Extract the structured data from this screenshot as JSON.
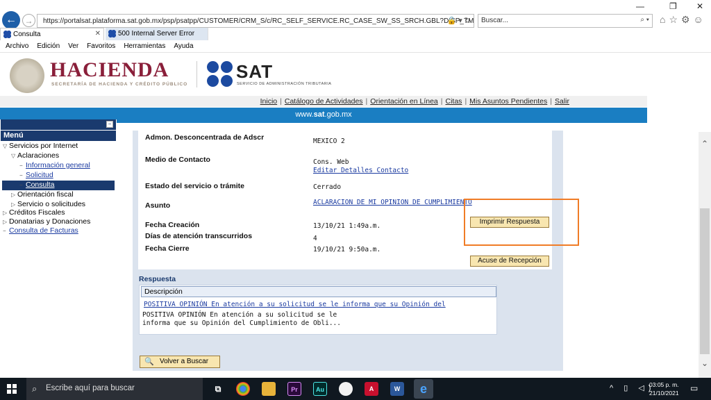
{
  "browser": {
    "url": "https://portalsat.plataforma.sat.gob.mx/psp/psatpp/CUSTOMER/CRM_S/c/RC_SELF_SERVICE.RC_CASE_SW_SS_SRCH.GBL?DISP_TMPL_ID=RC_SU",
    "search_placeholder": "Buscar...",
    "tabs": [
      {
        "label": "Consulta"
      },
      {
        "label": "500 Internal Server Error"
      }
    ],
    "menu": [
      "Archivo",
      "Edición",
      "Ver",
      "Favoritos",
      "Herramientas",
      "Ayuda"
    ]
  },
  "header": {
    "hacienda": "HACIENDA",
    "hacienda_sub": "SECRETARÍA DE HACIENDA Y CRÉDITO PÚBLICO",
    "sat": "SAT",
    "sat_sub": "SERVICIO DE ADMINISTRACIÓN TRIBUTARIA",
    "top_links": [
      "Inicio",
      "Catálogo de Actividades",
      "Orientación en Línea",
      "Citas",
      "Mis Asuntos Pendientes",
      "Salir"
    ],
    "site_pre": "www.",
    "site_bold": "sat",
    "site_post": ".gob.mx"
  },
  "sidebar": {
    "title": "Menú",
    "collapse": "−",
    "items": [
      {
        "label": "Servicios por Internet",
        "toggle": "▽"
      },
      {
        "label": "Aclaraciones",
        "toggle": "▽"
      },
      {
        "label": "Información general",
        "toggle": "−"
      },
      {
        "label": "Solicitud",
        "toggle": "−"
      },
      {
        "label": "Consulta",
        "toggle": "−"
      },
      {
        "label": "Orientación fiscal",
        "toggle": "▷"
      },
      {
        "label": "Servicio o solicitudes",
        "toggle": "▷"
      },
      {
        "label": "Créditos Fiscales",
        "toggle": "▷"
      },
      {
        "label": "Donatarias y Donaciones",
        "toggle": "▷"
      },
      {
        "label": "Consulta de Facturas",
        "toggle": "−"
      }
    ]
  },
  "details": {
    "admon_label": "Admon. Desconcentrada de Adscr",
    "admon_value": "MEXICO 2",
    "medio_label": "Medio de Contacto",
    "medio_value": "Cons. Web",
    "medio_link": "Editar Detalles Contacto",
    "estado_label": "Estado del servicio o trámite",
    "estado_value": "Cerrado",
    "asunto_label": "Asunto",
    "asunto_value": "ACLARACION DE MI OPINION DE CUMPLIMIENTO",
    "creacion_label": "Fecha Creación",
    "creacion_value": "13/10/21  1:49a.m.",
    "dias_label": "Días de atención transcurridos",
    "dias_value": "4",
    "cierre_label": "Fecha Cierre",
    "cierre_value": "19/10/21  9:50a.m.",
    "imprimir_button": "Imprimir Respuesta",
    "acuse_button": "Acuse de Recepción"
  },
  "respuesta": {
    "title": "Respuesta",
    "header": "Descripción",
    "link": "POSITIVA OPINIÓN En atención a su solicitud se le informa que su Opinión del",
    "text": "POSITIVA OPINIÓN En atención a su solicitud se le informa que su Opinión del Cumplimiento de Obli..."
  },
  "volver_button": "Volver a Buscar",
  "taskbar": {
    "search": "Escribe aquí para buscar",
    "time": "03:05 p. m.",
    "date": "21/10/2021"
  },
  "colors": {
    "accent_blue": "#1a7ec2",
    "menu_navy": "#1a3a6e",
    "hacienda_red": "#8a1f3a",
    "highlight_orange": "#f07c26"
  }
}
